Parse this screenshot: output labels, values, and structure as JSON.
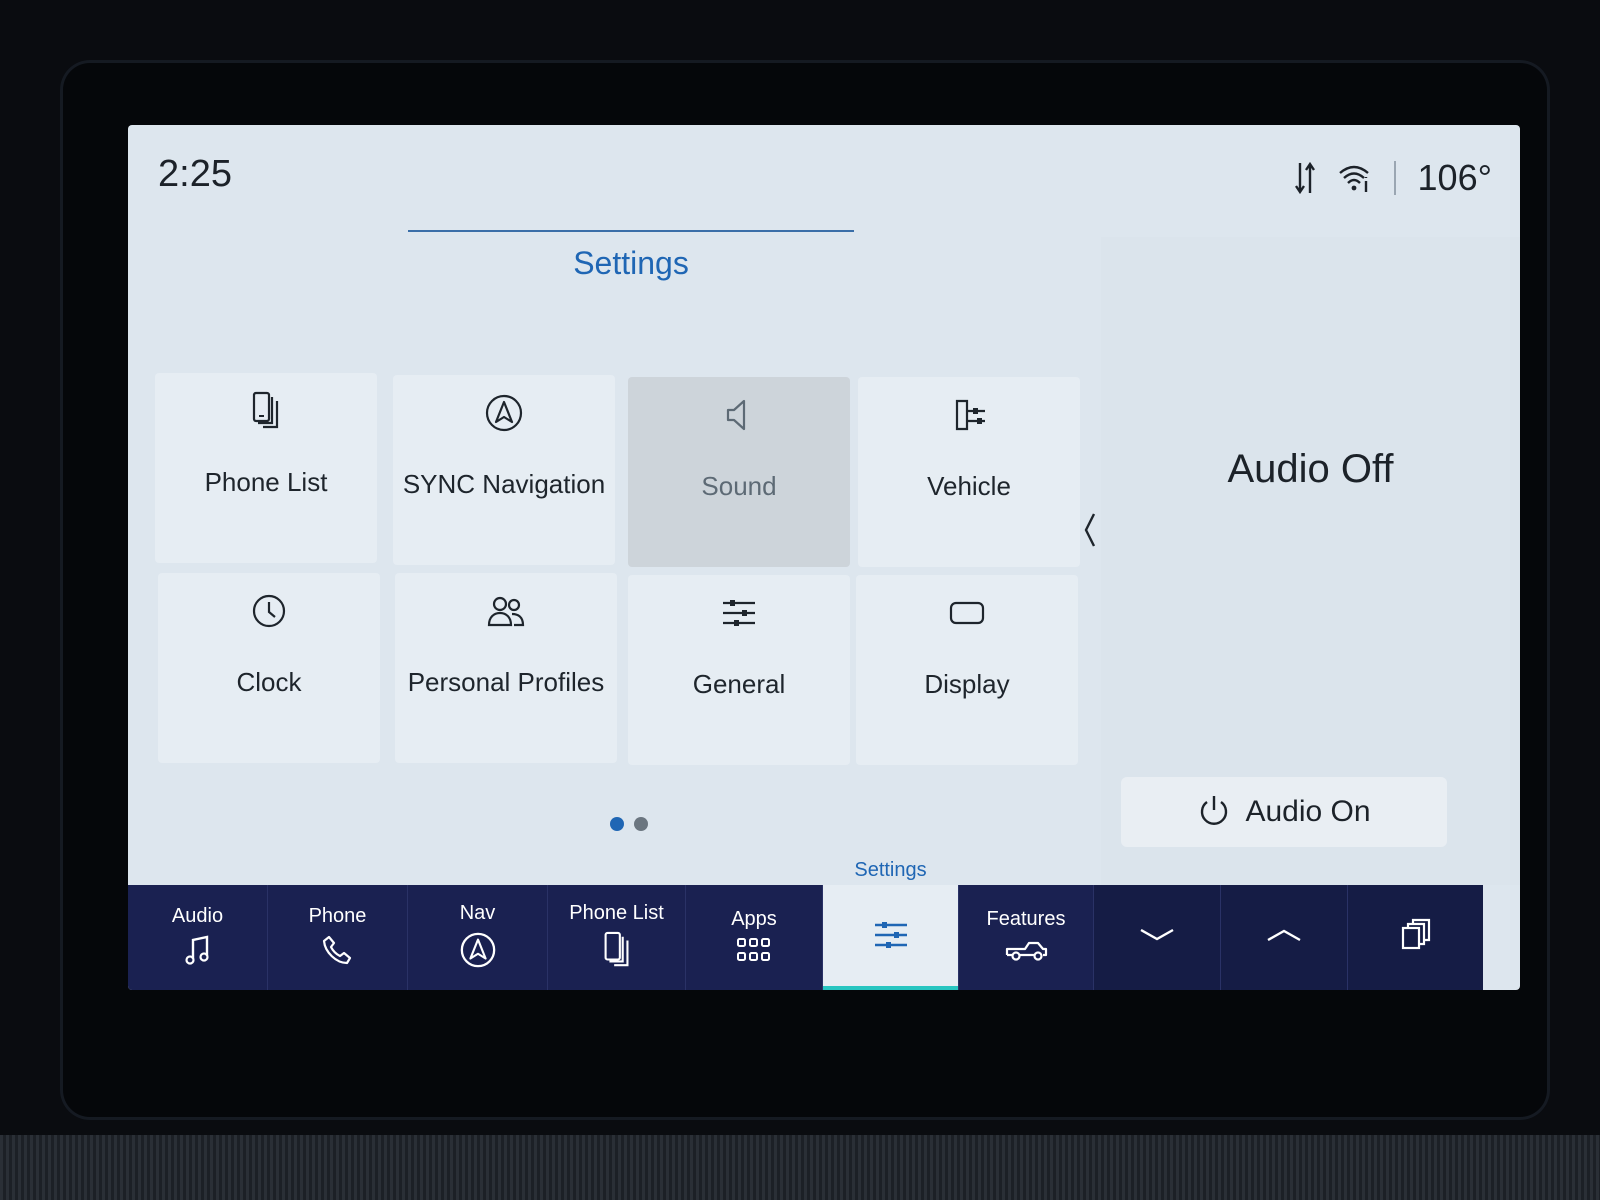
{
  "status_bar": {
    "time": "2:25",
    "temperature": "106°",
    "icons": [
      "data-transfer-icon",
      "wifi-info-icon"
    ]
  },
  "settings": {
    "title": "Settings",
    "tiles": [
      {
        "label": "Phone List",
        "icon": "phone-list-icon"
      },
      {
        "label": "SYNC Navigation",
        "icon": "navigation-icon"
      },
      {
        "label": "Sound",
        "icon": "speaker-icon"
      },
      {
        "label": "Vehicle",
        "icon": "vehicle-settings-icon"
      },
      {
        "label": "Clock",
        "icon": "clock-icon"
      },
      {
        "label": "Personal Profiles",
        "icon": "profiles-icon"
      },
      {
        "label": "General",
        "icon": "sliders-icon"
      },
      {
        "label": "Display",
        "icon": "display-icon"
      }
    ],
    "pages": {
      "current": 1,
      "total": 2
    }
  },
  "audio_panel": {
    "status": "Audio Off",
    "button_label": "Audio On"
  },
  "bottom_nav": {
    "items": [
      {
        "label": "Audio",
        "icon": "music-note-icon"
      },
      {
        "label": "Phone",
        "icon": "phone-handset-icon"
      },
      {
        "label": "Nav",
        "icon": "navigation-icon"
      },
      {
        "label": "Phone List",
        "icon": "phone-list-icon"
      },
      {
        "label": "Apps",
        "icon": "apps-grid-icon"
      },
      {
        "label": "Settings",
        "icon": "sliders-icon"
      },
      {
        "label": "Features",
        "icon": "truck-icon"
      }
    ],
    "controls": [
      "chevron-down-icon",
      "chevron-up-icon",
      "copy-windows-icon"
    ]
  },
  "colors": {
    "accent_blue": "#1f66b4",
    "nav_background": "#1a2151",
    "active_underline": "#27c5c0",
    "pager_active": "#1f66b4",
    "pager_inactive": "#6b7680"
  }
}
